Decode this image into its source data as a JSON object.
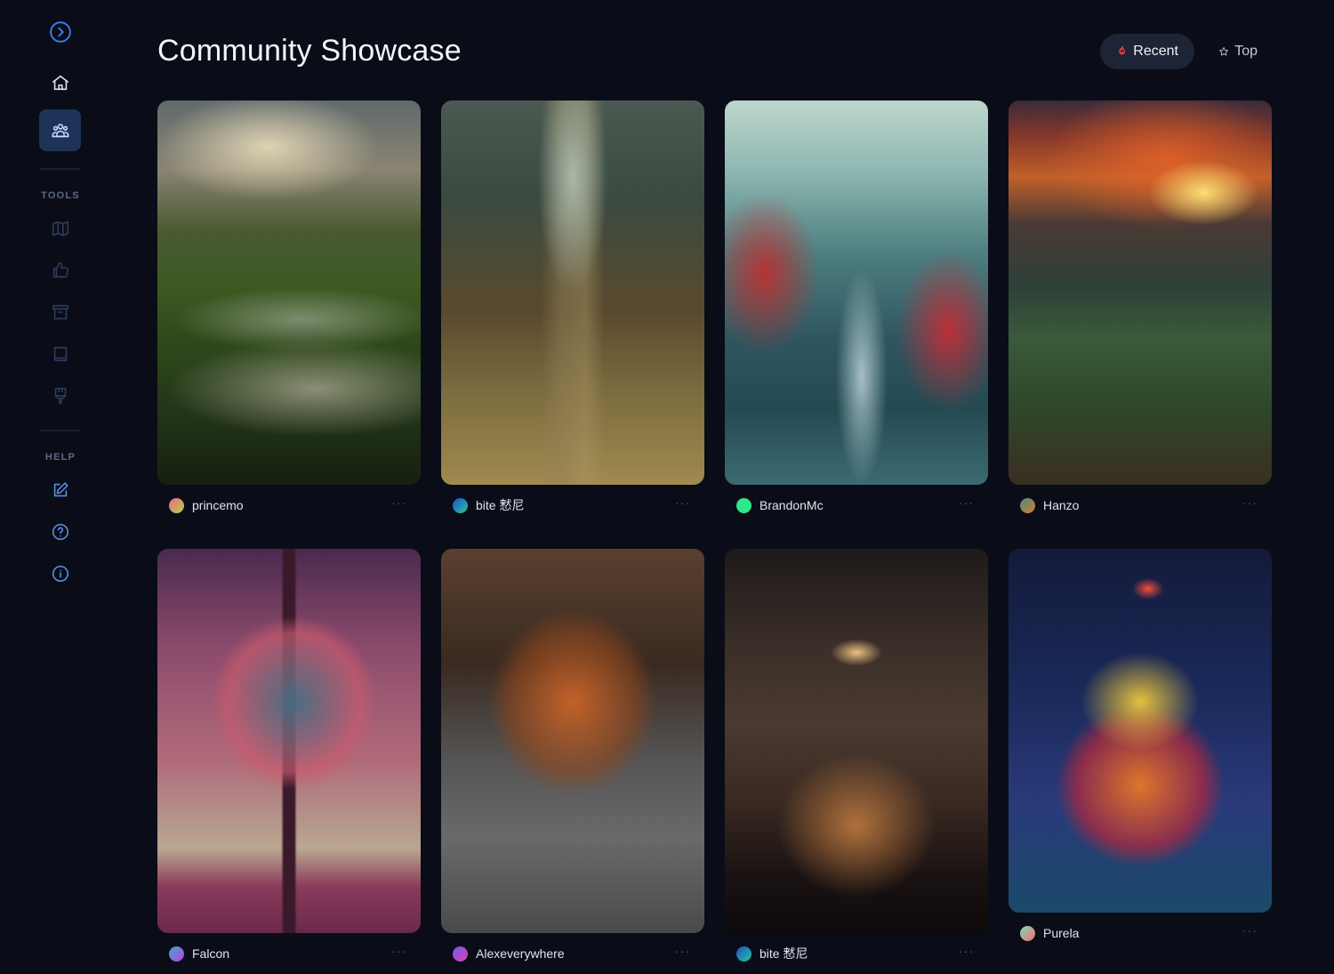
{
  "sidebar": {
    "toggle_icon": "chevron-right-circle-icon",
    "nav": [
      {
        "name": "home",
        "icon": "home-icon",
        "active": false
      },
      {
        "name": "community",
        "icon": "users-icon",
        "active": true
      }
    ],
    "tools_label": "TOOLS",
    "tools": [
      {
        "name": "map",
        "icon": "map-icon"
      },
      {
        "name": "like",
        "icon": "thumbs-up-icon"
      },
      {
        "name": "archive",
        "icon": "archive-icon"
      },
      {
        "name": "book",
        "icon": "book-icon"
      },
      {
        "name": "brush",
        "icon": "brush-icon"
      }
    ],
    "help_label": "HELP",
    "help": [
      {
        "name": "feedback",
        "icon": "edit-icon"
      },
      {
        "name": "faq",
        "icon": "help-circle-icon"
      },
      {
        "name": "about",
        "icon": "info-icon"
      }
    ]
  },
  "header": {
    "title": "Community Showcase",
    "sort": {
      "recent_label": "Recent",
      "recent_icon": "flame-icon",
      "top_label": "Top",
      "top_icon": "star-icon",
      "selected": "Recent"
    }
  },
  "accent": "#3b82f6",
  "cards": [
    {
      "user": "princemo",
      "image": "river valley landscape at sunrise",
      "avatar_colors": [
        "#e86a8a",
        "#b9d24a"
      ]
    },
    {
      "user": "bite 慭尼",
      "image": "steep alley staircase between tall old buildings",
      "avatar_colors": [
        "#1f4fc9",
        "#22c6a0"
      ]
    },
    {
      "user": "BrandonMc",
      "image": "waterfall with red trees and castle",
      "avatar_colors": [
        "#2ee88a",
        "#2ee88a"
      ]
    },
    {
      "user": "Hanzo",
      "image": "mountain valley sunset with river",
      "avatar_colors": [
        "#3f8f7d",
        "#e07a2e"
      ]
    },
    {
      "user": "Falcon",
      "image": "tree made of clouds",
      "avatar_colors": [
        "#3aa8c9",
        "#c440e6"
      ]
    },
    {
      "user": "Alexeverywhere",
      "image": "fox resting in knitted blanket",
      "avatar_colors": [
        "#6a5cf0",
        "#e43fb1"
      ]
    },
    {
      "user": "bite 慭尼",
      "image": "kids reading in cluttered library",
      "avatar_colors": [
        "#1f4fc9",
        "#22c6a0"
      ]
    },
    {
      "user": "Purela",
      "image": "neon colorful monster with goggles",
      "avatar_colors": [
        "#7be0a8",
        "#f36a7a"
      ]
    }
  ],
  "more_label": "···"
}
